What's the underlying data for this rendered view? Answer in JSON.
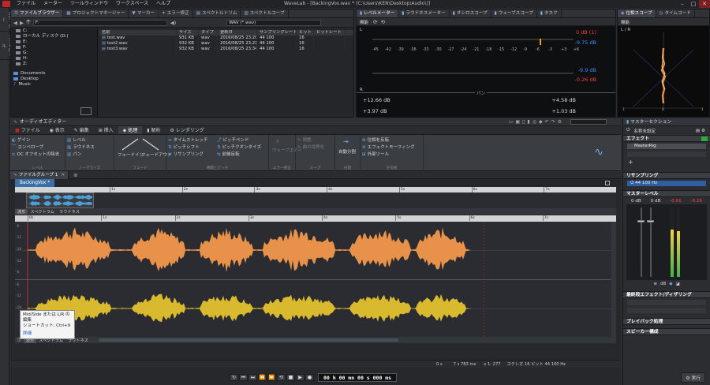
{
  "app": {
    "window_title": "WaveLab - [BackingVox.wav * (C:\\Users\\KEN\\Desktop\\Audio\\)]",
    "menu": [
      "ファイル",
      "メーター",
      "ツールウィンドウ",
      "ワークスペース",
      "ヘルプ"
    ],
    "controls": {
      "minimize": "–",
      "maximize": "□",
      "close": "✕"
    }
  },
  "left_dock": {
    "tabs": [
      "エディター",
      "コントロール"
    ]
  },
  "file_browser": {
    "tabs": [
      "ファイルブラウザー",
      "プロジェクトマネージャー",
      "マーカー",
      "エラー修正",
      "スペクトルトリム",
      "スペクトルコープ"
    ],
    "path": "F:",
    "filter": "WAV (*.wav)",
    "tree": [
      {
        "label": "C:"
      },
      {
        "label": "ローカル ディスク (D:)"
      },
      {
        "label": "E:"
      },
      {
        "label": "F:"
      },
      {
        "label": "G:"
      },
      {
        "label": "H:"
      },
      {
        "label": "Z:"
      },
      {
        "label": "Documents"
      },
      {
        "label": "Desktop"
      },
      {
        "label": "Music"
      }
    ],
    "columns": [
      "名前",
      "サイズ",
      "タイプ",
      "更新日",
      "サンプリングレート",
      "ビット",
      "ビットレート"
    ],
    "files": [
      [
        "test.wav",
        "931 KB",
        "wav",
        "2016/08/25 23:20",
        "44 100",
        "16",
        ""
      ],
      [
        "test2.wav",
        "932 KB",
        "wav",
        "2016/08/25 23:21",
        "44 100",
        "16",
        ""
      ],
      [
        "test3.wav",
        "932 KB",
        "wav",
        "2016/08/25 23:34",
        "44 100",
        "16",
        ""
      ]
    ]
  },
  "level_meter": {
    "tabs": [
      "レベルメーター",
      "ラウドネスメーター",
      "オシロスコープ",
      "ウェーブスコープ",
      "タスク"
    ],
    "settings_label": "機能",
    "scale": [
      "-45",
      "-42",
      "-39",
      "-36",
      "-33",
      "-30",
      "-27",
      "-24",
      "-21",
      "-18",
      "-15",
      "-12",
      "-9",
      "-6",
      "-3",
      "+3",
      "+6"
    ],
    "channel_labels": [
      "L",
      "R"
    ],
    "readouts": {
      "peak_l": "0 dB (1)",
      "rms_l": "-9.75 dB",
      "rms_r": "-9.9 dB",
      "peak_r": "-0.26 dB"
    },
    "pan_label": "パン",
    "pan_left_1": "+12.66 dB",
    "pan_right_1": "+4.58 dB",
    "pan_left_2": "+3.97 dB",
    "pan_right_2": "+1.03 dB",
    "bottom_scale": [
      "5",
      "5",
      "3",
      "3",
      "3",
      "2",
      "3",
      "3",
      "2",
      "1",
      "1",
      "1",
      "1",
      "1"
    ],
    "colors": {
      "peak": "#ff3b3b",
      "rms": "#3f8cff",
      "marker": "#f4a000"
    }
  },
  "phase_scope": {
    "tabs": [
      "位相スコープ",
      "タイムコード"
    ],
    "settings_label": "機能",
    "axis_label": "L / R",
    "scale_marks": [
      "1",
      "0",
      "1"
    ]
  },
  "editor": {
    "title": "オーディオエディター",
    "ribbon_tabs": [
      "ファイル",
      "表示",
      "編集",
      "挿入",
      "処理",
      "解析",
      "レンダリング"
    ],
    "active_ribbon_tab": "処理",
    "groups": {
      "level": {
        "label": "レベル",
        "buttons": [
          "ゲイン",
          "レベル",
          "エンベロープ",
          "ラウドネス",
          "DC オフセットの除去",
          "パン"
        ]
      },
      "noise": {
        "label": "ノーマライズ"
      },
      "fade": {
        "label": "フェード",
        "buttons": [
          "フェードイン",
          "フェードアウト"
        ]
      },
      "time_pitch": {
        "label": "時間とピッチ",
        "buttons": [
          "タイムストレッチ",
          "ピッチベンド",
          "ピッチシフト",
          "ピッチクオンタイズ",
          "リサンプリング",
          "前後反転"
        ]
      },
      "silence": {
        "label": "エラー修正",
        "buttons": [
          "ウェーブエディ"
        ]
      },
      "loop": {
        "label": "ループ",
        "buttons": [
          "調整",
          "曲の境界化"
        ]
      },
      "split": {
        "label": "分割",
        "buttons": [
          "自動分割"
        ]
      },
      "other": {
        "label": "その他",
        "buttons": [
          "位相を反転",
          "エフェクトモーフィング",
          "外部ツール"
        ]
      }
    },
    "file_group_tab": "ファイルグループ 1",
    "doc_tab": "BackingVox *",
    "overview_ruler": [
      "1s",
      "2s",
      "3s",
      "4s",
      "5s",
      "6s",
      "7s"
    ],
    "main_ruler": [
      "0s",
      "1s",
      "2s",
      "3s",
      "4s",
      "5s",
      "6s",
      "7s"
    ],
    "view_tabs": [
      "波形",
      "スペクトラム",
      "ラウドネス"
    ],
    "db_labels_top": [
      "-6",
      "-12",
      "-18",
      "-12",
      "-6"
    ],
    "db_labels_bottom": [
      "-6",
      "-12",
      "-18",
      "-12",
      "-6"
    ],
    "colors": {
      "channel_l": "#e8914a",
      "channel_r": "#d9b92e",
      "overview": "#3c97d6"
    },
    "tooltip": {
      "line1": "Mid/Side または L/R の編集",
      "line2": "ショートカット: Ctrl+9",
      "link": "詳細"
    },
    "status": {
      "cursor": "0 s",
      "selection": "7 s 783 ms",
      "zoom": "x 1: 277",
      "format": "ステレオ 16 ビット 44 100 Hz"
    },
    "timecode": "00 h 00 mn 00 s 000 ms"
  },
  "master_section": {
    "title": "マスターセクション",
    "preset_label": "名称未設定",
    "effects_label": "エフェクト",
    "effect_slot": "MasterRig",
    "resampling_label": "リサンプリング",
    "resampling_value": "44 100 Hz",
    "master_level_label": "マスターレベル",
    "level_values": [
      "0 dB",
      "0 dB",
      "-0.01",
      "-0.26"
    ],
    "final_effects_label": "最終段エフェクト/ディザリング",
    "playback_label": "プレイバック処理",
    "speaker_label": "スピーカー構成",
    "render_button": "実行"
  }
}
